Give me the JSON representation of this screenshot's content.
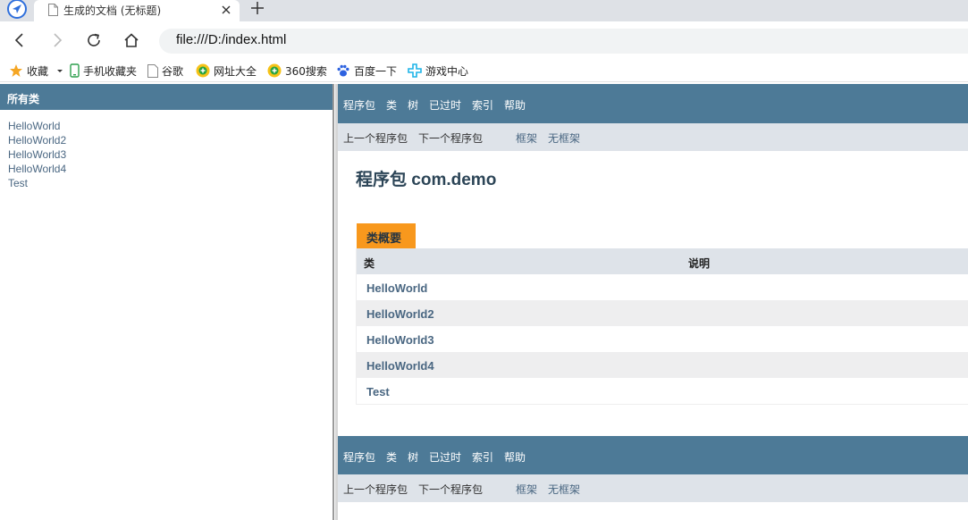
{
  "browser": {
    "tab_title": "生成的文档 (无标题)",
    "url": "file:///D:/index.html",
    "bookmarks": [
      "收藏",
      "手机收藏夹",
      "谷歌",
      "网址大全",
      "360搜索",
      "百度一下",
      "游戏中心"
    ]
  },
  "left_frame": {
    "header": "所有类",
    "classes": [
      "HelloWorld",
      "HelloWorld2",
      "HelloWorld3",
      "HelloWorld4",
      "Test"
    ]
  },
  "right_frame": {
    "nav": [
      "程序包",
      "类",
      "树",
      "已过时",
      "索引",
      "帮助"
    ],
    "subnav": {
      "prev_package": "上一个程序包",
      "next_package": "下一个程序包",
      "frames": "框架",
      "no_frames": "无框架"
    },
    "package_title": "程序包 com.demo",
    "class_summary": {
      "caption": "类概要",
      "columns": [
        "类",
        "说明"
      ],
      "rows": [
        "HelloWorld",
        "HelloWorld2",
        "HelloWorld3",
        "HelloWorld4",
        "Test"
      ]
    }
  },
  "colors": {
    "nav_bg": "#4d7a97",
    "subnav_bg": "#dee3e9",
    "caption_bg": "#f8981d",
    "link": "#4a6782",
    "row_alt": "#eeeeef"
  }
}
